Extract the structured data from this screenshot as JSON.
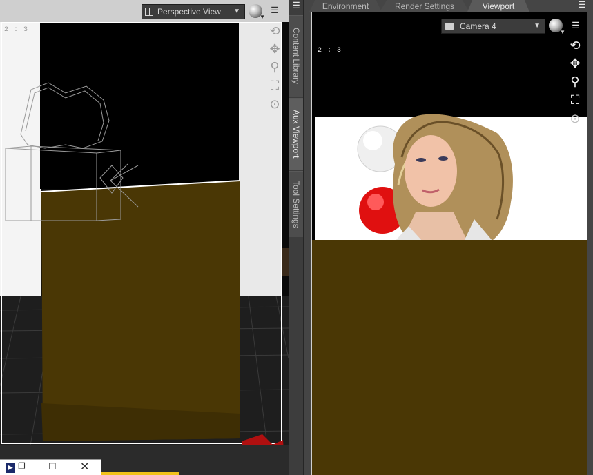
{
  "left_viewport": {
    "view_selector": "Perspective View",
    "aspect_ratio": "2 : 3",
    "nav_icons": [
      "orbit-icon",
      "pan-icon",
      "zoom-icon",
      "frame-icon",
      "reset-icon"
    ]
  },
  "side_tabs": [
    {
      "label": "Content Library",
      "active": false
    },
    {
      "label": "Aux Viewport",
      "active": true
    },
    {
      "label": "Tool Settings",
      "active": false
    }
  ],
  "right_panel": {
    "tabs": [
      {
        "label": "Environment",
        "active": false
      },
      {
        "label": "Render Settings",
        "active": false
      },
      {
        "label": "Viewport",
        "active": true
      }
    ],
    "camera_selector": "Camera 4",
    "aspect_ratio": "2 : 3",
    "nav_icons": [
      "orbit-icon",
      "pan-icon",
      "zoom-icon",
      "frame-icon",
      "reset-icon"
    ]
  },
  "colors": {
    "ground_plane": "#4a3705",
    "backdrop": "#ffffff",
    "red_sphere": "#e01010",
    "white_sphere": "#f0f0f0",
    "taskbar_strip": "#f2c21a"
  }
}
